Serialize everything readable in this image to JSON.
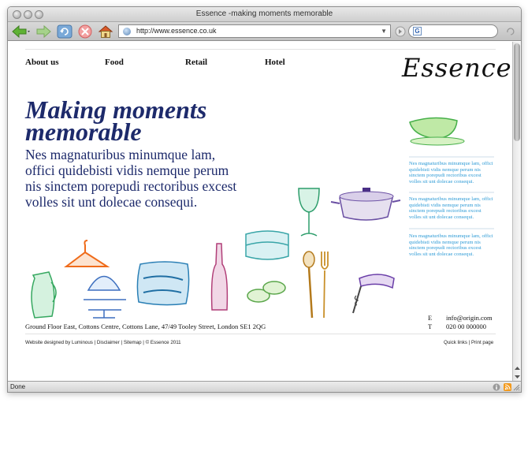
{
  "browser": {
    "window_title": "Essence -making moments memorable",
    "url": "http://www.essence.co.uk",
    "status": "Done"
  },
  "page": {
    "nav": [
      "About us",
      "Food",
      "Retail",
      "Hotel"
    ],
    "logo_text": "Essence",
    "headline_line1": "Making moments",
    "headline_line2": "memorable",
    "intro": "Nes magnaturibus minumque lam, offici quidebisti vidis nemque perum nis sinctem porepudi rectoribus excest volles sit unt dolecae consequi.",
    "side_blocks": [
      "Nes magnaturibus minumque lam, offici quidebisti vidis nemque perum nis sinctem porepudi rectoribus excest volles sit unt dolecae consequi.",
      "Nes magnaturibus minumque lam, offici quidebisti vidis nemque perum nis sinctem porepudi rectoribus excest volles sit unt dolecae consequi.",
      "Nes magnaturibus minumque lam, offici quidebisti vidis nemque perum nis sinctem porepudi rectoribus excest volles sit unt dolecae consequi."
    ],
    "address": "Ground Floor East, Cottons Centre, Cottons Lane, 47/49 Tooley Street, London  SE1 2QG",
    "email_label": "E",
    "email": "info@origin.com",
    "phone_label": "T",
    "phone": "020 00 000000",
    "footer_left": "Website designed by Luminous | Disclaimer | Sitemap | © Essence 2011",
    "footer_right": "Quick links | Print page"
  },
  "colors": {
    "headline": "#1d2a6b",
    "side_text": "#2e9bd6"
  }
}
